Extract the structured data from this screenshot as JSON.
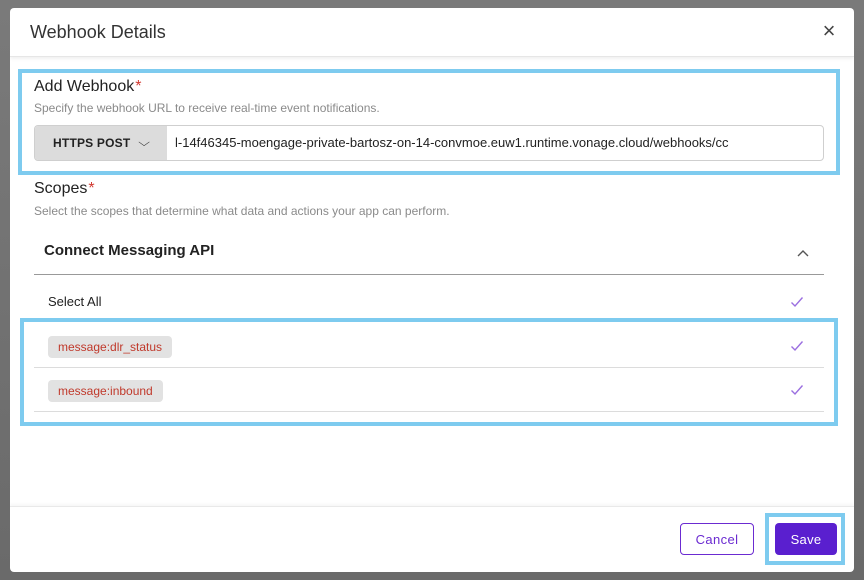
{
  "dialog": {
    "title": "Webhook Details",
    "close_label": "×"
  },
  "webhook": {
    "label": "Add Webhook",
    "required_mark": "*",
    "hint": "Specify the webhook URL to receive real-time event notifications.",
    "method": "HTTPS POST",
    "url_value": "l-14f46345-moengage-private-bartosz-on-14-convmoe.euw1.runtime.vonage.cloud/webhooks/cc"
  },
  "scopes": {
    "label": "Scopes",
    "required_mark": "*",
    "hint": "Select the scopes that determine what data and actions your app can perform.",
    "group_title": "Connect Messaging API",
    "select_all_label": "Select All",
    "items": [
      {
        "label": "message:dlr_status",
        "checked": true
      },
      {
        "label": "message:inbound",
        "checked": true
      }
    ]
  },
  "footer": {
    "cancel_label": "Cancel",
    "save_label": "Save"
  },
  "colors": {
    "accent": "#5a1fcf",
    "highlight": "#7ecbef",
    "required": "#d0372f",
    "scope_chip_text": "#c0392b",
    "check": "#9b6fe0"
  },
  "icons": {
    "close": "close-icon",
    "method_dropdown": "chevron-down-icon",
    "accordion": "chevron-up-icon",
    "checks": "check-icon"
  }
}
